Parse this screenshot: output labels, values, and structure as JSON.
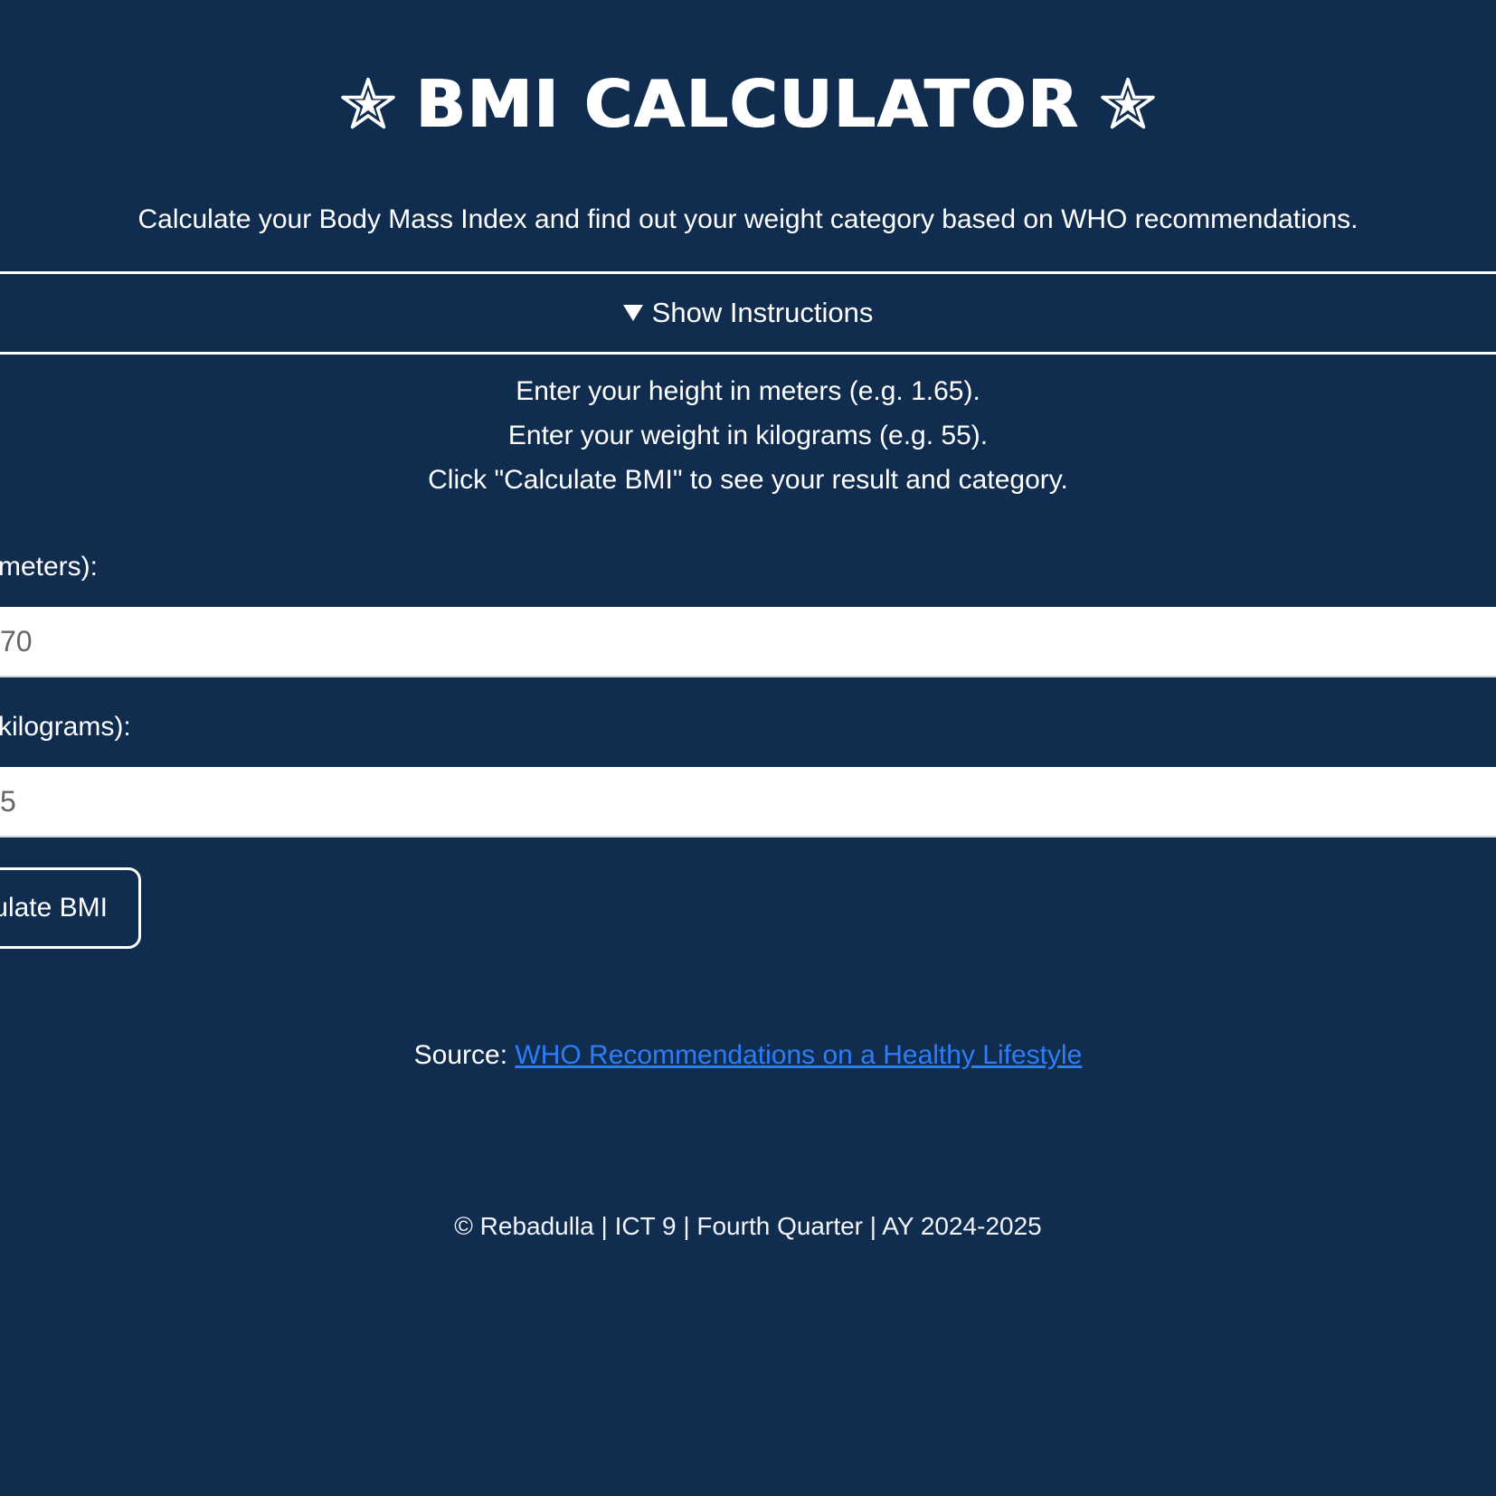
{
  "header": {
    "title": "BMI CALCULATOR",
    "subtitle": "Calculate your Body Mass Index and find out your weight category based on WHO recommendations.",
    "left_icon": "star-icon",
    "right_icon": "star-icon"
  },
  "instructions_toggle": {
    "label": "Show Instructions",
    "icon": "triangle-down-icon"
  },
  "instructions": {
    "lines": [
      "Enter your height in meters (e.g. 1.65).",
      "Enter your weight in kilograms (e.g. 55).",
      "Click \"Calculate BMI\" to see your result and category."
    ]
  },
  "form": {
    "height_label": "(meters):",
    "height_value": "70",
    "weight_label": "(kilograms):",
    "weight_value": "5",
    "button_label": "ulate BMI"
  },
  "source": {
    "prefix": "Source:",
    "link_text": "WHO Recommendations on a Healthy Lifestyle"
  },
  "footer": {
    "text": "© Rebadulla | ICT 9 | Fourth Quarter | AY 2024-2025"
  },
  "colors": {
    "background": "#102d50",
    "text": "#ffffff",
    "link": "#2e7df7",
    "input_background": "#ffffff"
  }
}
